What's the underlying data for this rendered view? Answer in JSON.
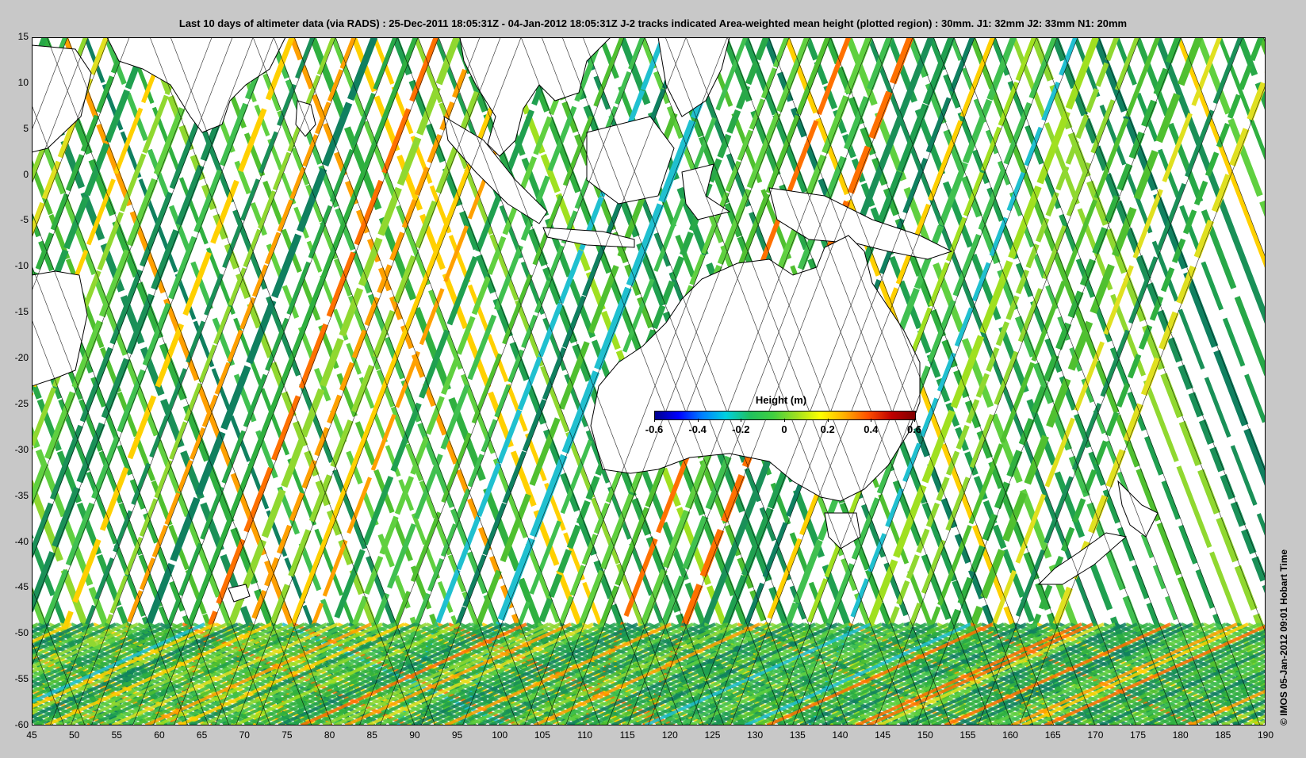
{
  "title": "Last 10 days of altimeter data (via RADS) : 25-Dec-2011 18:05:31Z - 04-Jan-2012 18:05:31Z  J-2 tracks indicated  Area-weighted mean height (plotted region) : 30mm.  J1: 32mm  J2: 33mm  N1: 20mm",
  "credit": "© IMOS 05-Jan-2012 09:01 Hobart Time",
  "axes": {
    "x": {
      "min": 45,
      "max": 190,
      "ticks": [
        "45",
        "50",
        "55",
        "60",
        "65",
        "70",
        "75",
        "80",
        "85",
        "90",
        "95",
        "100",
        "105",
        "110",
        "115",
        "120",
        "125",
        "130",
        "135",
        "140",
        "145",
        "150",
        "155",
        "160",
        "165",
        "170",
        "175",
        "180",
        "185",
        "190"
      ]
    },
    "y": {
      "min": -60,
      "max": 15,
      "ticks": [
        "15",
        "10",
        "5",
        "0",
        "-5",
        "-10",
        "-15",
        "-20",
        "-25",
        "-30",
        "-35",
        "-40",
        "-45",
        "-50",
        "-55",
        "-60"
      ]
    }
  },
  "colorbar": {
    "title": "Height (m)",
    "ticks": [
      "-0.6",
      "-0.4",
      "-0.2",
      "0",
      "0.2",
      "0.4",
      "0.6"
    ]
  },
  "colors": {
    "land": "#ffffff",
    "background": "#c8c8c8",
    "track_main": "#30b040",
    "track_dark": "#108060"
  },
  "layers": [
    "altimeter-swath-tracks",
    "J-2-ground-tracks",
    "coastline"
  ]
}
